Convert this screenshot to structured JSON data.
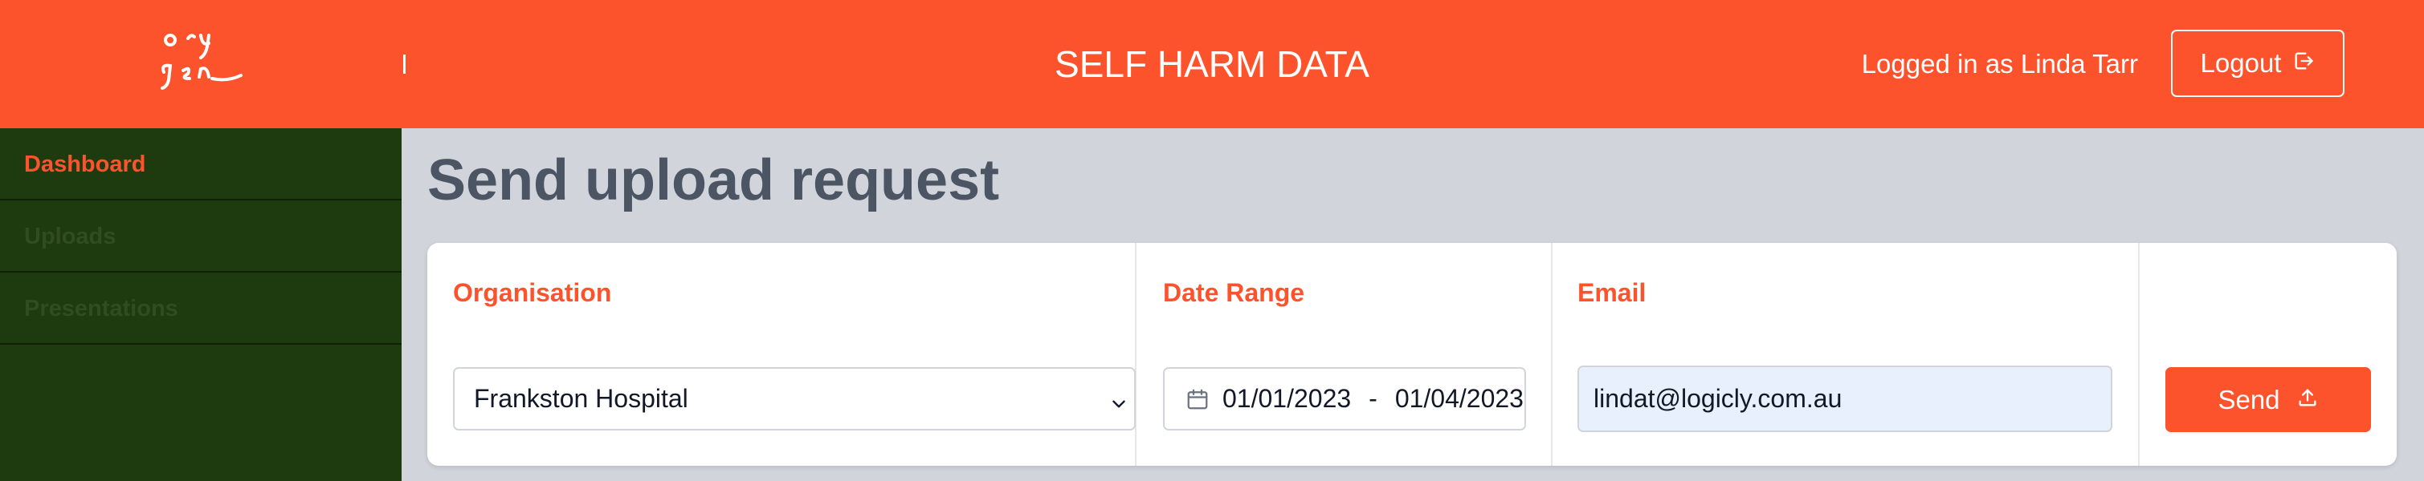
{
  "header": {
    "logo": "orygen-logo",
    "title": "SELF HARM DATA",
    "logged_in_text": "Logged in as Linda Tarr",
    "logout_label": "Logout",
    "logout_icon": "logout-icon",
    "background_color": "#fd532d"
  },
  "sidebar": {
    "background_color": "#1e3a0f",
    "items": [
      {
        "label": "Dashboard",
        "active": true
      },
      {
        "label": "Uploads",
        "active": false
      },
      {
        "label": "Presentations",
        "active": false
      }
    ]
  },
  "main": {
    "page_title": "Send upload request",
    "form": {
      "organisation_label": "Organisation",
      "organisation_value": "Frankston Hospital",
      "organisation_icon": "chevron-down-icon",
      "date_range_label": "Date Range",
      "date_start": "01/01/2023",
      "date_separator": "-",
      "date_end": "01/04/2023",
      "date_icon": "calendar-icon",
      "email_label": "Email",
      "email_value": "lindat@logicly.com.au",
      "send_label": "Send",
      "send_icon": "upload-icon"
    }
  }
}
